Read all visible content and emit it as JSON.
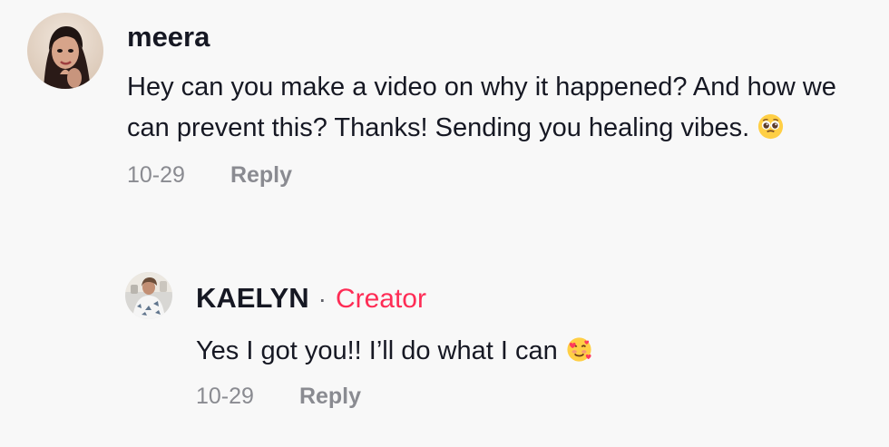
{
  "comments": [
    {
      "username": "meera",
      "text": "Hey can you make a video on why it happened? And how we can prevent this? Thanks! Sending you healing vibes.",
      "emoji": "pleading-face-icon",
      "date": "10-29",
      "reply_label": "Reply"
    }
  ],
  "reply": {
    "username": "KAELYN",
    "separator": "·",
    "badge": "Creator",
    "text": "Yes I got you!! I’ll do what I can",
    "emoji": "smiling-face-with-hearts-icon",
    "date": "10-29",
    "reply_label": "Reply"
  },
  "colors": {
    "background": "#f8f8f8",
    "text": "#161823",
    "muted": "#8a8b91",
    "creator": "#fe2c55"
  }
}
